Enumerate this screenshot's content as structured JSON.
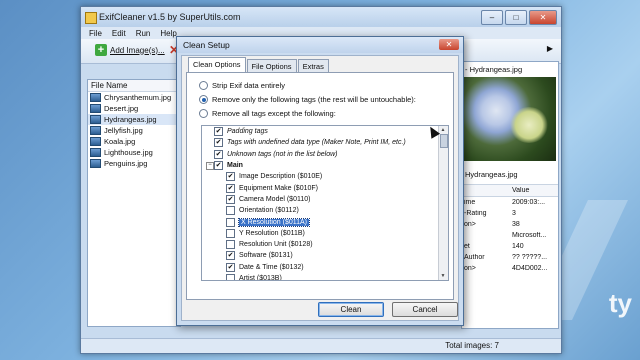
{
  "window": {
    "title": "ExifCleaner v1.5 by SuperUtils.com",
    "menu": [
      "File",
      "Edit",
      "Run",
      "Help"
    ],
    "toolbar": {
      "add_label": "Add Image(s)..."
    },
    "file_list": {
      "header": "File Name",
      "files": [
        "Chrysanthemum.jpg",
        "Desert.jpg",
        "Hydrangeas.jpg",
        "Jellyfish.jpg",
        "Koala.jpg",
        "Lighthouse.jpg",
        "Penguins.jpg"
      ],
      "selected_index": 2
    },
    "preview": {
      "title": "- Hydrangeas.jpg",
      "caption": "Hydrangeas.jpg",
      "value_header": "Value",
      "rows": [
        {
          "k": "ime",
          "v": "2009:03:..."
        },
        {
          "k": "-Rating",
          "v": "3"
        },
        {
          "k": "on>",
          "v": "38"
        },
        {
          "k": "",
          "v": "Microsoft..."
        },
        {
          "k": "et",
          "v": "140"
        },
        {
          "k": "Author",
          "v": "?? ?????..."
        },
        {
          "k": "on>",
          "v": "4D4D002..."
        }
      ]
    },
    "status": "Total images: 7"
  },
  "dialog": {
    "title": "Clean Setup",
    "tabs": [
      "Clean Options",
      "File Options",
      "Extras"
    ],
    "options": [
      {
        "label": "Strip Exif data entirely",
        "selected": false
      },
      {
        "label": "Remove only the following tags (the rest will be untouchable):",
        "selected": true
      },
      {
        "label": "Remove all tags except the following:",
        "selected": false
      }
    ],
    "tags": [
      {
        "label": "Padding tags",
        "checked": true,
        "style": "ital",
        "indent": 1
      },
      {
        "label": "Tags with undefined data type (Maker Note, Print IM, etc.)",
        "checked": true,
        "style": "ital",
        "indent": 1
      },
      {
        "label": "Unknown tags (not in the list below)",
        "checked": true,
        "style": "ital",
        "indent": 1
      },
      {
        "label": "Main",
        "checked": true,
        "style": "bold",
        "indent": 1,
        "tree": true
      },
      {
        "label": "Image Description ($010E)",
        "checked": true,
        "style": "",
        "indent": 2
      },
      {
        "label": "Equipment Make ($010F)",
        "checked": true,
        "style": "",
        "indent": 2
      },
      {
        "label": "Camera Model ($0110)",
        "checked": true,
        "style": "",
        "indent": 2
      },
      {
        "label": "Orientation ($0112)",
        "checked": false,
        "style": "",
        "indent": 2
      },
      {
        "label": "X Resolution ($011A)",
        "checked": false,
        "style": "sel",
        "indent": 2
      },
      {
        "label": "Y Resolution ($011B)",
        "checked": false,
        "style": "",
        "indent": 2
      },
      {
        "label": "Resolution Unit ($0128)",
        "checked": false,
        "style": "",
        "indent": 2
      },
      {
        "label": "Software ($0131)",
        "checked": true,
        "style": "",
        "indent": 2
      },
      {
        "label": "Date & Time ($0132)",
        "checked": true,
        "style": "",
        "indent": 2
      },
      {
        "label": "Artist ($013B)",
        "checked": false,
        "style": "",
        "indent": 2
      }
    ],
    "buttons": {
      "clean": "Clean",
      "cancel": "Cancel"
    }
  },
  "watermark": "ty"
}
